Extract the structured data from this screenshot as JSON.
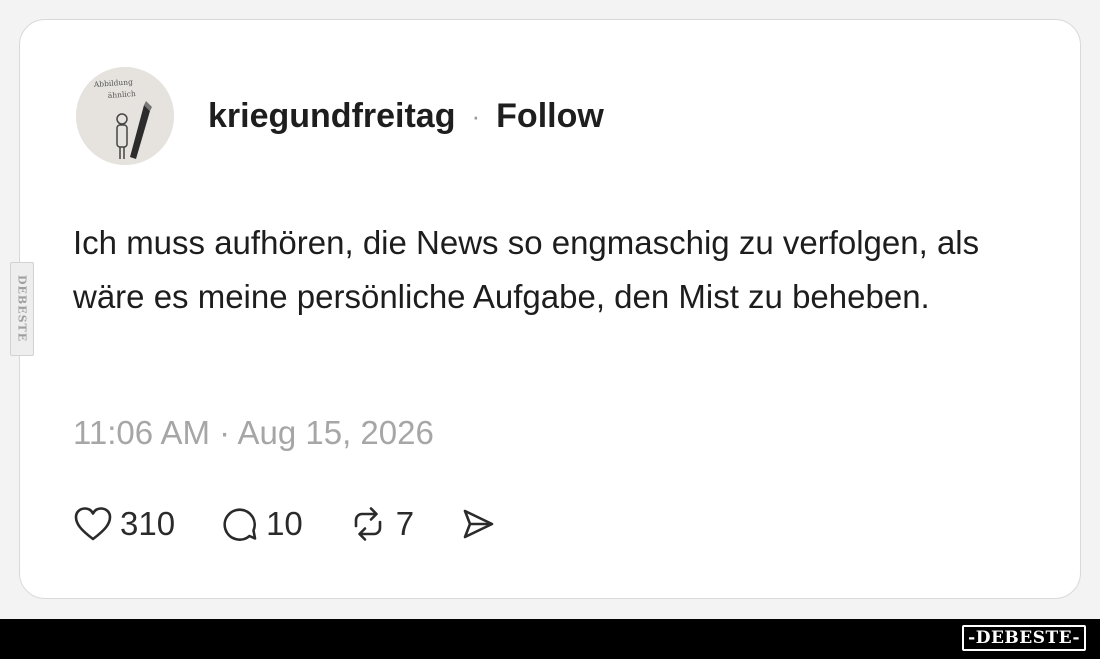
{
  "post": {
    "username": "kriegundfreitag",
    "separator": "·",
    "follow_label": "Follow",
    "avatar_caption_line1": "Abbildung",
    "avatar_caption_line2": "ähnlich",
    "text": "Ich muss aufhören, die News so engmaschig zu verfolgen, als wäre es meine persönliche Aufgabe, den Mist zu beheben.",
    "timestamp": "11:06 AM · Aug 15, 2026",
    "actions": {
      "likes": "310",
      "replies": "10",
      "reposts": "7"
    }
  },
  "icons": {
    "like": "heart-icon",
    "reply": "comment-bubble-icon",
    "repost": "repost-arrows-icon",
    "share": "send-icon"
  },
  "watermarks": {
    "side": "DEBESTE",
    "footer": "-DEBESTE-"
  },
  "colors": {
    "background": "#f3f3f3",
    "card": "#ffffff",
    "card_border": "#d9d9d9",
    "text": "#1d1d1d",
    "muted": "#a6a6a6",
    "footer_bar": "#000000"
  }
}
